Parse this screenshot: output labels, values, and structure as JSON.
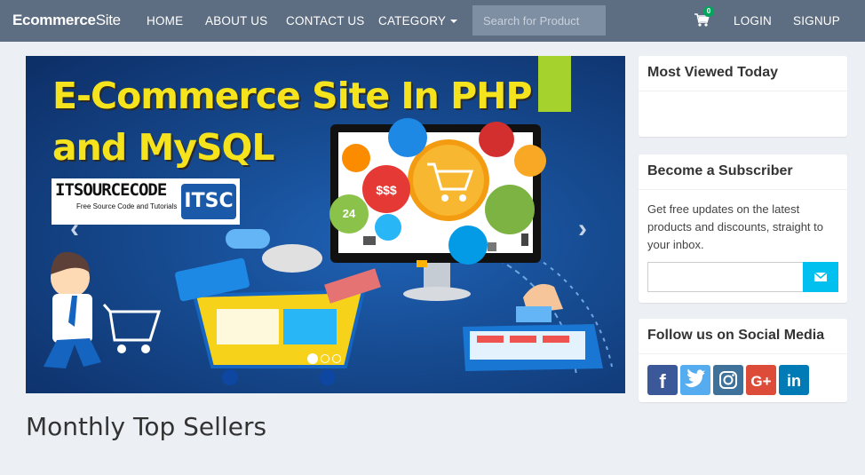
{
  "navbar": {
    "brand_bold": "Ecommerce",
    "brand_light": "Site",
    "links": [
      "HOME",
      "ABOUT US",
      "CONTACT US",
      "CATEGORY"
    ],
    "search_placeholder": "Search for Product",
    "cart_count": "0",
    "login": "LOGIN",
    "signup": "SIGNUP",
    "icons": {
      "cart": "shopping-cart-icon",
      "caret": "caret-down-icon"
    }
  },
  "carousel": {
    "title_line1": "E-Commerce Site In PHP",
    "title_line2": "and MySQL",
    "logo_text": "ITSOURCECODE",
    "logo_sub": "Free Source Code and Tutorials",
    "logo_mark": "ITSC",
    "slide_count": 3,
    "active_slide": 1,
    "prev_icon": "chevron-left-icon",
    "next_icon": "chevron-right-icon"
  },
  "main": {
    "section_title": "Monthly Top Sellers"
  },
  "sidebar": {
    "most_viewed_title": "Most Viewed Today",
    "subscribe_title": "Become a Subscriber",
    "subscribe_text": "Get free updates on the latest products and discounts, straight to your inbox.",
    "subscribe_icon": "envelope-icon",
    "social_title": "Follow us on Social Media",
    "social": [
      {
        "name": "facebook-icon",
        "glyph": "f",
        "color": "#3b5998"
      },
      {
        "name": "twitter-icon",
        "glyph": "",
        "color": "#55acee"
      },
      {
        "name": "instagram-icon",
        "glyph": "",
        "color": "#3f729b"
      },
      {
        "name": "google-plus-icon",
        "glyph": "G+",
        "color": "#dd4b39"
      },
      {
        "name": "linkedin-icon",
        "glyph": "in",
        "color": "#007bb6"
      }
    ]
  }
}
